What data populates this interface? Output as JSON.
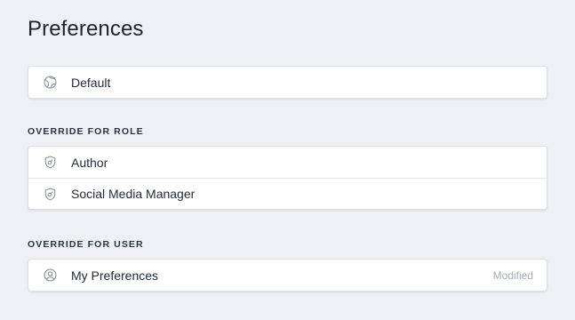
{
  "page": {
    "title": "Preferences"
  },
  "default_section": {
    "items": [
      {
        "label": "Default",
        "icon": "globe-icon"
      }
    ]
  },
  "role_section": {
    "heading": "OVERRIDE FOR ROLE",
    "items": [
      {
        "label": "Author",
        "icon": "shield-icon"
      },
      {
        "label": "Social Media Manager",
        "icon": "shield-icon"
      }
    ]
  },
  "user_section": {
    "heading": "OVERRIDE FOR USER",
    "items": [
      {
        "label": "My Preferences",
        "icon": "user-circle-icon",
        "badge": "Modified"
      }
    ]
  },
  "colors": {
    "background": "#eef0f5",
    "card": "#ffffff",
    "icon": "#8a92a0",
    "badge_text": "#a5acb8"
  }
}
